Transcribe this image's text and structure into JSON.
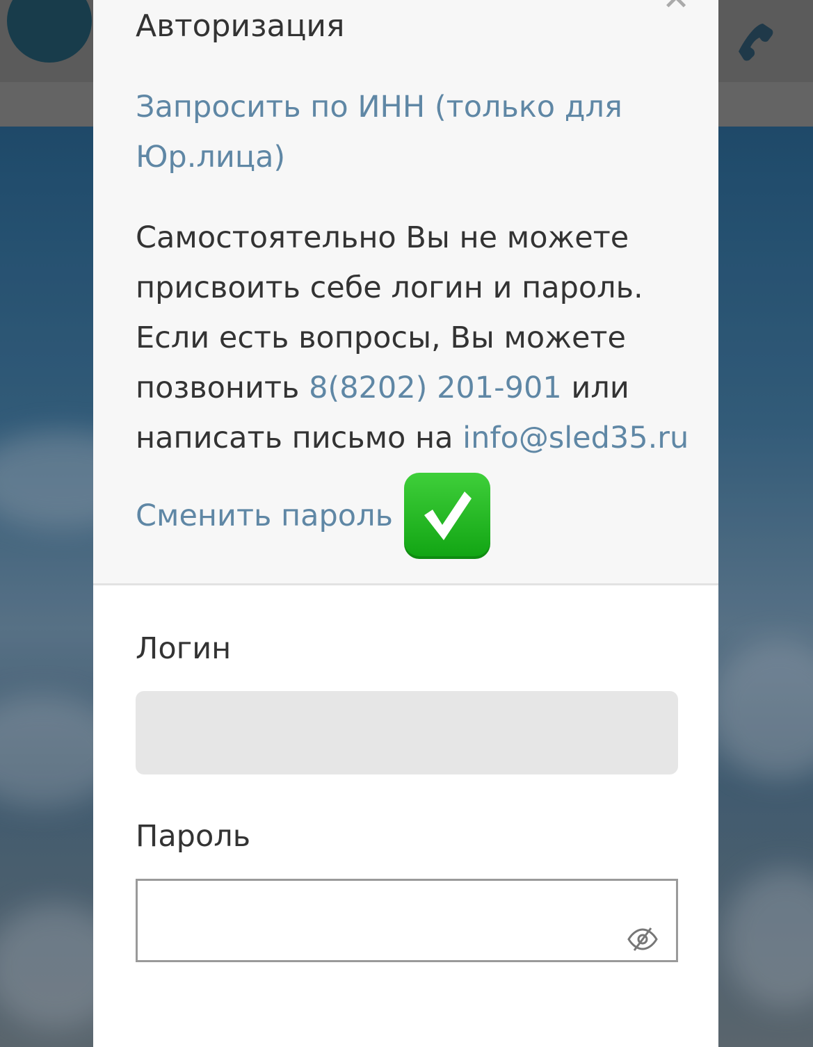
{
  "modal": {
    "title": "Авторизация",
    "close_symbol": "✕",
    "inn_link": "Запросить по ИНН (только для Юр.лица)",
    "info": {
      "text_before_phone": "Самостоятельно Вы не можете присвоить себе логин и пароль. Если есть вопросы, Вы можете позвонить ",
      "phone": "8(8202) 201-901",
      "text_between": " или написать письмо на ",
      "email": "info@sled35.ru"
    },
    "change_password_link": "Сменить пароль",
    "change_password_emoji": "check-mark-button"
  },
  "form": {
    "login_label": "Логин",
    "login_value": "",
    "password_label": "Пароль",
    "password_value": ""
  },
  "colors": {
    "link": "#5f87a5",
    "text": "#333333",
    "emoji_green": "#17ad18"
  }
}
